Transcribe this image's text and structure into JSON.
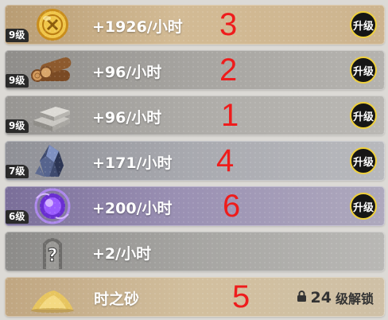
{
  "rows": [
    {
      "level": "9级",
      "rate": "+1926/小时",
      "order": "3",
      "upgrade": "升级",
      "icon": "gold-coin-icon"
    },
    {
      "level": "9级",
      "rate": "+96/小时",
      "order": "2",
      "upgrade": "升级",
      "icon": "wood-logs-icon"
    },
    {
      "level": "9级",
      "rate": "+96/小时",
      "order": "1",
      "upgrade": "升级",
      "icon": "stone-bricks-icon"
    },
    {
      "level": "7级",
      "rate": "+171/小时",
      "order": "4",
      "upgrade": "升级",
      "icon": "crystal-ore-icon"
    },
    {
      "level": "6级",
      "rate": "+200/小时",
      "order": "6",
      "upgrade": "升级",
      "icon": "purple-orb-icon"
    },
    {
      "rate": "+2/小时",
      "icon": "mystery-item-icon"
    },
    {
      "name": "时之砂",
      "order": "5",
      "locked_num": "24",
      "locked_text": "级解锁",
      "icon": "sand-pile-icon"
    }
  ],
  "colors": {
    "row_gold": "#c9ae86",
    "row_gray": "#9a9894",
    "row_purple": "#8e84a6",
    "order_red": "#ee1c1c",
    "upgrade_ring": "#f0d13c"
  }
}
